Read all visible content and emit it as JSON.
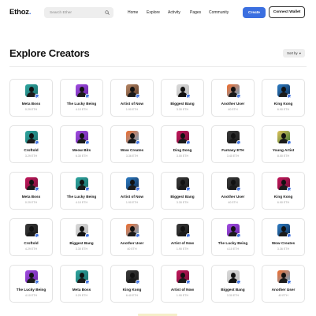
{
  "header": {
    "logo_main": "Ethoz",
    "logo_accent": ".",
    "search_placeholder": "Search Ether",
    "nav": [
      "Home",
      "Explore",
      "Activity",
      "Pages",
      "Community"
    ],
    "create_label": "Create",
    "connect_label": "Connect Wallet"
  },
  "main": {
    "title": "Explore Creators",
    "sort_label": "Sort by",
    "sort_chevron": "▾"
  },
  "colors": {
    "accent": "#3b6fe0",
    "avatar_pink": "#c2185b",
    "avatar_purple": "#a14de0",
    "avatar_teal": "#2fa6a0",
    "avatar_orange": "#f06b2a",
    "avatar_blue": "#2e7dc4",
    "avatar_gray": "#d9d9d9"
  },
  "creators": [
    {
      "name": "Meta Boss",
      "value": "0.29 ETH",
      "avatar": "teal"
    },
    {
      "name": "The Lucky Being",
      "value": "4.10 ETH",
      "avatar": "purple"
    },
    {
      "name": "Artist of Now",
      "value": "1.90 ETH",
      "avatar": "brown"
    },
    {
      "name": "Biggest Bang",
      "value": "3.30 ETH",
      "avatar": "gray"
    },
    {
      "name": "Another User",
      "value": "40 ETH",
      "avatar": "orange"
    },
    {
      "name": "King Kong",
      "value": "6.90 ETH",
      "avatar": "blue"
    },
    {
      "name": "Croftold",
      "value": "3.29 ETH",
      "avatar": "teal"
    },
    {
      "name": "Meow Bits",
      "value": "6.30 ETH",
      "avatar": "purple"
    },
    {
      "name": "Wow Creates",
      "value": "3.36 ETH",
      "avatar": "orange"
    },
    {
      "name": "Ding Dong",
      "value": "3.00 ETH",
      "avatar": "pink"
    },
    {
      "name": "Fantasy ETH",
      "value": "3.40 ETH",
      "avatar": "dark"
    },
    {
      "name": "Young Artist",
      "value": "8.00 ETH",
      "avatar": "green"
    },
    {
      "name": "Meta Boss",
      "value": "0.29 ETH",
      "avatar": "pink"
    },
    {
      "name": "The Lucky Being",
      "value": "4.10 ETH",
      "avatar": "teal"
    },
    {
      "name": "Artist of Now",
      "value": "1.90 ETH",
      "avatar": "blue"
    },
    {
      "name": "Biggest Bang",
      "value": "3.30 ETH",
      "avatar": "dark"
    },
    {
      "name": "Another User",
      "value": "40 ETH",
      "avatar": "dark"
    },
    {
      "name": "King Kong",
      "value": "6.90 ETH",
      "avatar": "pink"
    },
    {
      "name": "Croftold",
      "value": "4.29 ETH",
      "avatar": "dark"
    },
    {
      "name": "Biggest Bang",
      "value": "3.30 ETH",
      "avatar": "gray"
    },
    {
      "name": "Another User",
      "value": "40 ETH",
      "avatar": "orange"
    },
    {
      "name": "Artist of Now",
      "value": "1.90 ETH",
      "avatar": "dark"
    },
    {
      "name": "The Lucky Being",
      "value": "4.10 ETH",
      "avatar": "purple"
    },
    {
      "name": "Wow Creates",
      "value": "3.36 ETH",
      "avatar": "blue"
    },
    {
      "name": "The Lucky Being",
      "value": "4.10 ETH",
      "avatar": "purple"
    },
    {
      "name": "Meta Boss",
      "value": "0.29 ETH",
      "avatar": "teal"
    },
    {
      "name": "King Kong",
      "value": "6.40 ETH",
      "avatar": "dark"
    },
    {
      "name": "Artist of Now",
      "value": "1.90 ETH",
      "avatar": "pink"
    },
    {
      "name": "Biggest Bang",
      "value": "3.30 ETH",
      "avatar": "gray"
    },
    {
      "name": "Another User",
      "value": "40 ETH",
      "avatar": "orange"
    }
  ]
}
